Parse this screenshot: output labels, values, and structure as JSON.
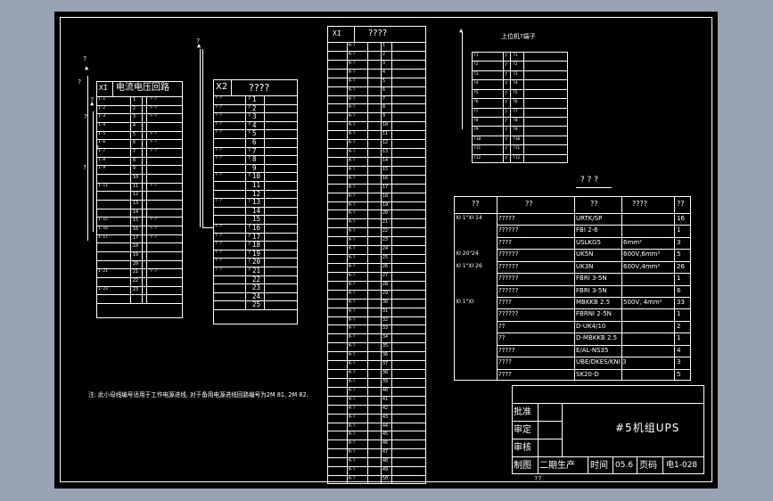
{
  "terminal_block_left": {
    "header_id": "XI",
    "header_title": "电流电压回路",
    "tick_label": "?",
    "rows": [
      [
        "1-1",
        "1",
        "?-?"
      ],
      [
        "1-2",
        "2",
        "?-?"
      ],
      [
        "1-3",
        "3",
        "?-?"
      ],
      [
        "1-4",
        "4",
        ""
      ],
      [
        "1-5",
        "5",
        "?-?"
      ],
      [
        "1-6",
        "6",
        "?-?"
      ],
      [
        "1-7",
        "7",
        "?-?"
      ],
      [
        "1-8",
        "8",
        ""
      ],
      [
        "1-9",
        "9",
        ""
      ],
      [
        "",
        "10",
        ""
      ],
      [
        "1-11",
        "11",
        "?-?"
      ],
      [
        "",
        "12",
        ""
      ],
      [
        "",
        "13",
        ""
      ],
      [
        "",
        "14",
        ""
      ],
      [
        "1-15",
        "15",
        "?-?"
      ],
      [
        "1-16",
        "16",
        "?-?"
      ],
      [
        "1-17",
        "17",
        "?-?"
      ],
      [
        "",
        "18",
        ""
      ],
      [
        "",
        "19",
        ""
      ],
      [
        "",
        "20",
        ""
      ],
      [
        "1-21",
        "21",
        "?-?"
      ],
      [
        "",
        "22",
        ""
      ],
      [
        "1-23",
        "23",
        ""
      ],
      [
        "",
        "",
        " "
      ]
    ]
  },
  "terminal_block_x2": {
    "header_id": "X2",
    "header_title": "????",
    "rows": [
      [
        "?-?",
        "?",
        "1"
      ],
      [
        "?-?",
        "?",
        "2"
      ],
      [
        "?-?",
        "?",
        "3"
      ],
      [
        "?-?",
        "?",
        "4"
      ],
      [
        "?-?",
        "?",
        "5"
      ],
      [
        "",
        "",
        "6"
      ],
      [
        "?-?",
        "?",
        "7"
      ],
      [
        "?-?",
        "?",
        "8"
      ],
      [
        "",
        "",
        "9"
      ],
      [
        "?-?",
        "?",
        "10"
      ],
      [
        "",
        "",
        "11"
      ],
      [
        "",
        "",
        "12"
      ],
      [
        "?-?",
        "?",
        "13"
      ],
      [
        "",
        "",
        "14"
      ],
      [
        "",
        "",
        "15"
      ],
      [
        "?-?",
        "?",
        "16"
      ],
      [
        "?-?",
        "?",
        "17"
      ],
      [
        "?-?",
        "?",
        "18"
      ],
      [
        "?-?",
        "?",
        "19"
      ],
      [
        "?-?",
        "?",
        "20"
      ],
      [
        "?-?",
        "?",
        "21"
      ],
      [
        "",
        "",
        "22"
      ],
      [
        "",
        "",
        "23"
      ],
      [
        "",
        "",
        "24"
      ],
      [
        "",
        "",
        "25"
      ]
    ]
  },
  "terminal_block_middle": {
    "header_id": "XI",
    "header_title": "????",
    "rows_count": 50
  },
  "terminal_block_upper_right": {
    "title": "上位机?端子",
    "rows": [
      [
        "?1",
        "?",
        "?1"
      ],
      [
        "?2",
        "?",
        "?2"
      ],
      [
        "?3",
        "?",
        "?3"
      ],
      [
        "?4",
        "?",
        "?4"
      ],
      [
        "?5",
        "?",
        "?5"
      ],
      [
        "?6",
        "?",
        "?6"
      ],
      [
        "?7",
        "?",
        "?7"
      ],
      [
        "?8",
        "?",
        "?8"
      ],
      [
        "?9",
        "?",
        "?9"
      ],
      [
        "?10",
        "?",
        "?10"
      ],
      [
        "?11",
        "?",
        "?11"
      ],
      [
        "?12",
        "?",
        "?12"
      ]
    ]
  },
  "bom_table": {
    "title": "? ? ?",
    "headers": [
      "??",
      "??",
      "??",
      "????",
      "??"
    ],
    "rows": [
      [
        "XI 1\"XI 14",
        "?????",
        "URTK/SP",
        "",
        "16"
      ],
      [
        "",
        "??????",
        "FBI 2-6",
        "",
        "1"
      ],
      [
        "",
        "????",
        "USLKG5",
        "6mm²",
        "3"
      ],
      [
        "XI 20\"24",
        "??????",
        "UK5N",
        "600V,6mm²",
        "5"
      ],
      [
        "XI 1\"XI 26",
        "??????",
        "UK3N",
        "600V,4mm²",
        "26"
      ],
      [
        "",
        "??????",
        "FBRI 3-5N",
        "",
        "1"
      ],
      [
        "",
        "??????",
        "FBRI 3-5N",
        "",
        "6"
      ],
      [
        "XI 1\"XI",
        "????",
        "MBKKB 2.5",
        "500V, 4mm²",
        "33"
      ],
      [
        "",
        "??????",
        "FBRNI 2-5N",
        "",
        "1"
      ],
      [
        "",
        "??",
        "D-UK4/10",
        "",
        "2"
      ],
      [
        "",
        "??",
        "D-MBKKB 2.5",
        "",
        "1"
      ],
      [
        "",
        "?????",
        "E/AL-NS35",
        "",
        "4"
      ],
      [
        "",
        "????",
        "UBE/DKES/KNI 3",
        "",
        "3"
      ],
      [
        "",
        "????",
        "SK20-D",
        "",
        "5"
      ]
    ]
  },
  "note": "注: 此小母线编号适用于工作电源进线, 对于备用电源进线回路编号为2M 81, 2M 82.",
  "title_block": {
    "labels": [
      "批准",
      "审定",
      "审核",
      "制图"
    ],
    "drawing_title": "#5机组UPS",
    "designer": "二期生产",
    "time_label": "时间",
    "time_value": "05.6",
    "page_label": "页码",
    "page_value": "电1-028",
    "below_mark": "??"
  },
  "colors": {
    "outer_background": "#98a4b4",
    "sheet": "#000000",
    "lines": "#ffffff"
  }
}
